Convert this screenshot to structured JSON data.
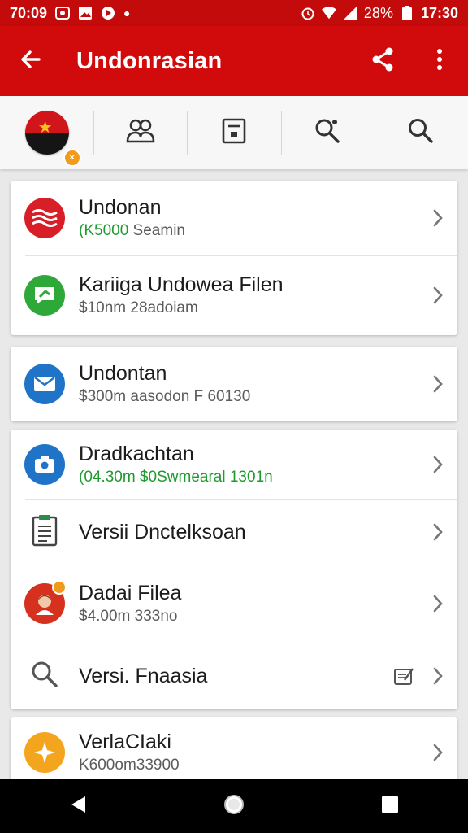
{
  "status_bar": {
    "time_left": "70:09",
    "battery_text": "28%",
    "time_right": "17:30"
  },
  "app_bar": {
    "title": "Undonrasian",
    "back_icon": "arrow-back-icon",
    "share_icon": "share-icon",
    "more_icon": "more-vert-icon"
  },
  "tabs": [
    {
      "name": "flag-avatar"
    },
    {
      "name": "people-icon"
    },
    {
      "name": "document-icon"
    },
    {
      "name": "search-settings-icon"
    },
    {
      "name": "search-icon"
    }
  ],
  "cards": [
    {
      "rows": [
        {
          "title": "Undonan",
          "subtitle": "(K5000 Seamin",
          "icon": "flag-wave-icon",
          "color": "#d81e26",
          "green_prefix": "(K5000",
          "sub_rest": " Seamin"
        },
        {
          "title": "Kariiga Undowea Filen",
          "subtitle": "$10nm 28adoiam",
          "icon": "chat-icon",
          "color": "#2fa83a"
        }
      ]
    },
    {
      "rows": [
        {
          "title": "Undontan",
          "subtitle": "$300m aasodon F 60130",
          "icon": "mail-icon",
          "color": "#1f74c8"
        }
      ]
    },
    {
      "rows": [
        {
          "title": "Dradkachtan",
          "subtitle": "(04.30m $0Swmearal 1301n",
          "icon": "camera-icon",
          "color": "#1f74c8"
        },
        {
          "title": "Versii Dnctelksoan",
          "subtitle": "",
          "icon": "clipboard-icon",
          "color": "#2a8c4a"
        },
        {
          "title": "Dadai Filea",
          "subtitle": "$4.00m 333no",
          "icon": "person-avatar-icon",
          "color": "#d6301f"
        },
        {
          "title": "Versi. Fnaasia",
          "subtitle": "",
          "icon": "search-icon",
          "color": "#555555",
          "extra_icon": "edit-note-icon"
        }
      ]
    },
    {
      "rows": [
        {
          "title": "VerlaCIaki",
          "subtitle": "K600om33900",
          "icon": "star-icon",
          "color": "#f4a51e"
        }
      ]
    }
  ],
  "nav_bar": {
    "back": "nav-back-icon",
    "home": "nav-home-icon",
    "recents": "nav-recents-icon"
  }
}
